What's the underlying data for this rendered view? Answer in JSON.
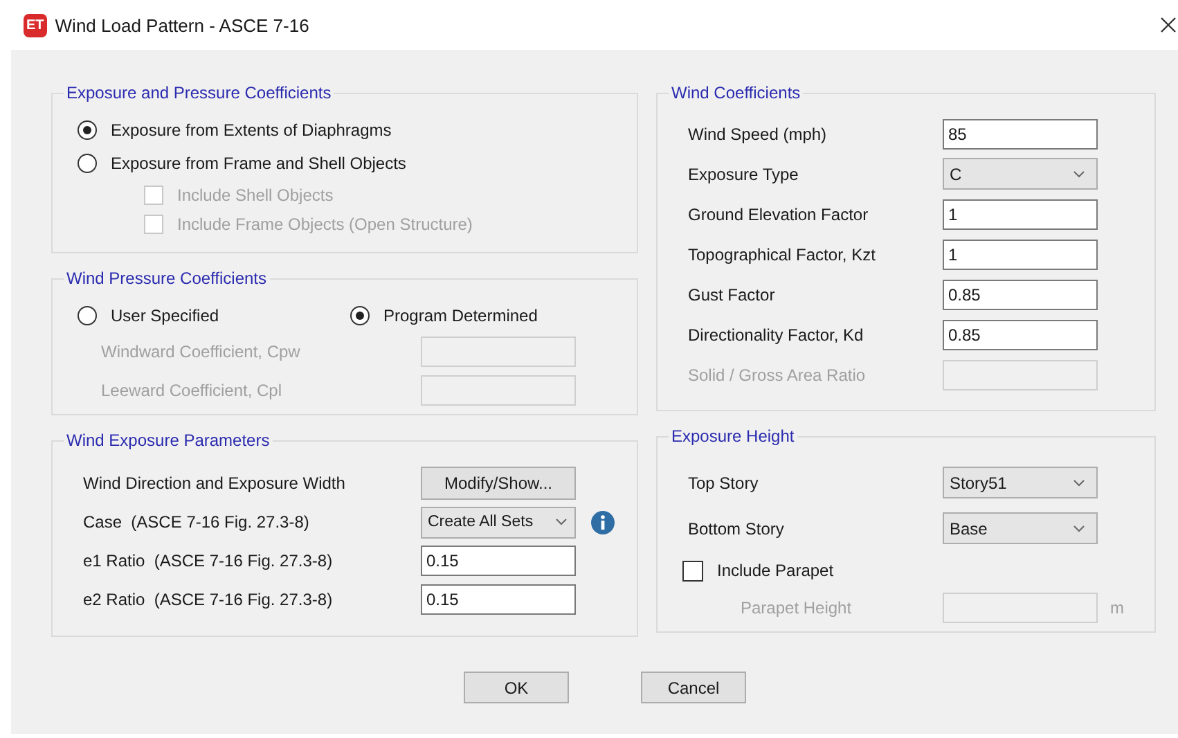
{
  "window": {
    "title": "Wind Load Pattern - ASCE 7-16",
    "app_icon": "ET"
  },
  "exposure_pressure": {
    "title": "Exposure and Pressure Coefficients",
    "options": [
      {
        "label": "Exposure from Extents of Diaphragms",
        "selected": true
      },
      {
        "label": "Exposure from Frame and Shell Objects",
        "selected": false
      }
    ],
    "sub_options": [
      {
        "label": "Include Shell Objects",
        "checked": false,
        "disabled": true
      },
      {
        "label": "Include Frame Objects (Open Structure)",
        "checked": false,
        "disabled": true
      }
    ]
  },
  "wind_pressure": {
    "title": "Wind Pressure Coefficients",
    "options": [
      {
        "label": "User Specified",
        "selected": false
      },
      {
        "label": "Program Determined",
        "selected": true
      }
    ],
    "fields": [
      {
        "label": "Windward Coefficient, Cpw",
        "disabled": true
      },
      {
        "label": "Leeward Coefficient, Cpl",
        "disabled": true
      }
    ]
  },
  "wind_exposure": {
    "title": "Wind Exposure Parameters",
    "rows": [
      {
        "kind": "button",
        "label": "Wind Direction and Exposure Width",
        "button": "Modify/Show..."
      },
      {
        "kind": "dropdown",
        "label": "Case  (ASCE 7-16 Fig. 27.3-8)",
        "value": "Create All Sets",
        "info": true
      },
      {
        "kind": "text",
        "label": "e1 Ratio  (ASCE 7-16 Fig. 27.3-8)",
        "value": "0.15"
      },
      {
        "kind": "text",
        "label": "e2 Ratio  (ASCE 7-16 Fig. 27.3-8)",
        "value": "0.15"
      }
    ]
  },
  "wind_coefficients": {
    "title": "Wind Coefficients",
    "rows": [
      {
        "kind": "text",
        "label": "Wind Speed (mph)",
        "value": "85",
        "disabled": false
      },
      {
        "kind": "dropdown",
        "label": "Exposure Type",
        "value": "C",
        "disabled": false
      },
      {
        "kind": "text",
        "label": "Ground Elevation Factor",
        "value": "1",
        "disabled": false
      },
      {
        "kind": "text",
        "label": "Topographical Factor, Kzt",
        "value": "1",
        "disabled": false
      },
      {
        "kind": "text",
        "label": "Gust Factor",
        "value": "0.85",
        "disabled": false
      },
      {
        "kind": "text",
        "label": "Directionality Factor, Kd",
        "value": "0.85",
        "disabled": false
      },
      {
        "kind": "text",
        "label": "Solid / Gross Area Ratio",
        "disabled": true
      }
    ]
  },
  "exposure_height": {
    "title": "Exposure Height",
    "rows": [
      {
        "kind": "dropdown",
        "label": "Top Story",
        "value": "Story51",
        "disabled": false
      },
      {
        "kind": "dropdown",
        "label": "Bottom Story",
        "value": "Base",
        "disabled": false
      },
      {
        "kind": "checkbox",
        "label": "Include Parapet",
        "checked": false,
        "disabled": false
      },
      {
        "kind": "subfield",
        "label": "Parapet Height",
        "unit": "m",
        "disabled": true
      }
    ]
  },
  "buttons": [
    "OK",
    "Cancel"
  ]
}
